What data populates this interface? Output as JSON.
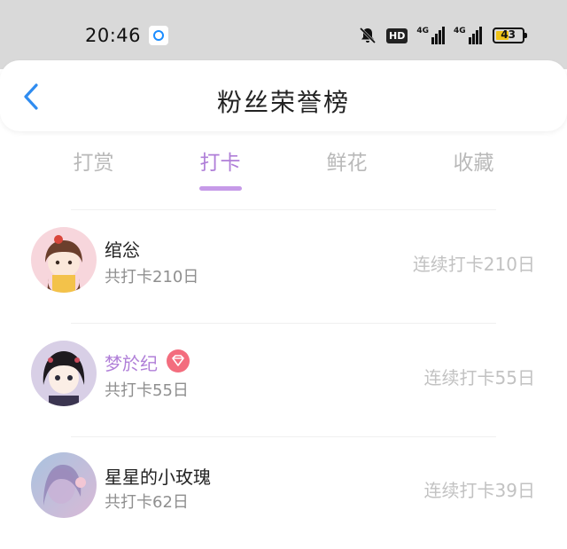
{
  "status_bar": {
    "time": "20:46",
    "hd_label": "HD",
    "network_1": "4G",
    "network_2": "4G",
    "battery_level": "43"
  },
  "header": {
    "title": "粉丝荣誉榜",
    "back_icon": "chevron-left-icon"
  },
  "tabs": [
    {
      "label": "打赏",
      "active": false
    },
    {
      "label": "打卡",
      "active": true
    },
    {
      "label": "鲜花",
      "active": false
    },
    {
      "label": "收藏",
      "active": false
    }
  ],
  "fans": [
    {
      "name": "绾忩",
      "total": "共打卡210日",
      "streak": "连续打卡210日",
      "vip": false
    },
    {
      "name": "梦於纪",
      "total": "共打卡55日",
      "streak": "连续打卡55日",
      "vip": true
    },
    {
      "name": "星星的小玫瑰",
      "total": "共打卡62日",
      "streak": "连续打卡39日",
      "vip": false
    }
  ],
  "colors": {
    "accent": "#b07fd8",
    "status_bar_bg": "#d9d9d9",
    "back_arrow": "#2f8cf0",
    "vip_badge": "#f36d7e",
    "inactive_tab": "#b9b9b9"
  }
}
